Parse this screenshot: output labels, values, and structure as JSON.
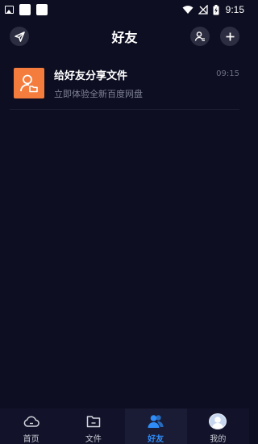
{
  "status_bar": {
    "time": "9:15",
    "icons": [
      "image-icon",
      "notification-square-icon",
      "notification-square-icon",
      "wifi-icon",
      "signal-icon",
      "battery-charging-icon"
    ]
  },
  "header": {
    "title": "好友",
    "icons": [
      "send-icon",
      "contacts-icon",
      "plus-icon"
    ]
  },
  "friends_list": [
    {
      "title": "给好友分享文件",
      "subtitle": "立即体验全新百度网盘",
      "time": "09:15",
      "icon": "share-friend-icon",
      "icon_color": "#f47c3c"
    }
  ],
  "tabbar": {
    "tabs": [
      {
        "label": "首页",
        "icon": "cloud-icon",
        "active": false
      },
      {
        "label": "文件",
        "icon": "folder-icon",
        "active": false
      },
      {
        "label": "好友",
        "icon": "friends-icon",
        "active": true
      },
      {
        "label": "我的",
        "icon": "avatar-icon",
        "active": false
      }
    ]
  },
  "colors": {
    "background": "#0d0e21",
    "accent": "#2f8cf7",
    "item_icon": "#f47c3c"
  }
}
